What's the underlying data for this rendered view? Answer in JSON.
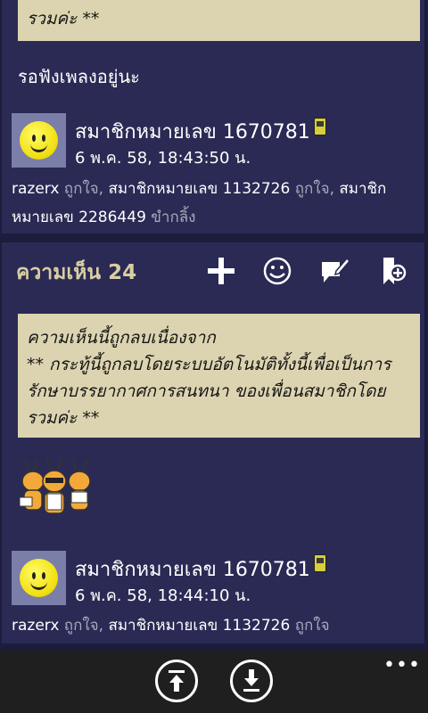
{
  "post1": {
    "notice_tail": "รวมค่ะ **",
    "status_text": "รอฟังเพลงอยู่นะ",
    "member_name": "สมาชิกหมายเลข 1670781",
    "timestamp": "6 พ.ค. 58, 18:43:50 น.",
    "likes": {
      "user1": "razerx",
      "verb1": "ถูกใจ,",
      "user2": "สมาชิกหมายเลข 1132726",
      "verb2": "ถูกใจ,",
      "user3": "สมาชิกหมายเลข 2286449",
      "verb3": "ขำกลิ้ง"
    }
  },
  "comment": {
    "title": "ความเห็น 24",
    "icons": [
      "plus-icon",
      "smiley-icon",
      "edit-note-icon",
      "bookmark-add-icon"
    ],
    "notice": {
      "line1": "ความเห็นนี้ถูกลบเนื่องจาก",
      "line2": "** กระทู้นี้ถูกลบโดยระบบอัตโนมัติทั้งนี้เพื่อเป็นการ",
      "line3": "รักษาบรรยากาศการสนทนา ของเพื่อนสมาชิกโดย",
      "line4": "รวมค่ะ **"
    },
    "member_name": "สมาชิกหมายเลข 1670781",
    "timestamp": "6 พ.ค. 58, 18:44:10 น.",
    "likes": {
      "user1": "razerx",
      "verb1": "ถูกใจ,",
      "user2": "สมาชิกหมายเลข 1132726",
      "verb2": "ถูกใจ"
    }
  },
  "appbar": {
    "icons": [
      "scroll-top-icon",
      "scroll-bottom-icon"
    ],
    "more_label": "•••"
  },
  "colors": {
    "background": "#1c1c3d",
    "card": "#2a2a55",
    "notice": "#dcd4b0",
    "accent_title": "#d9cea1",
    "appbar": "#1f1f1f"
  }
}
